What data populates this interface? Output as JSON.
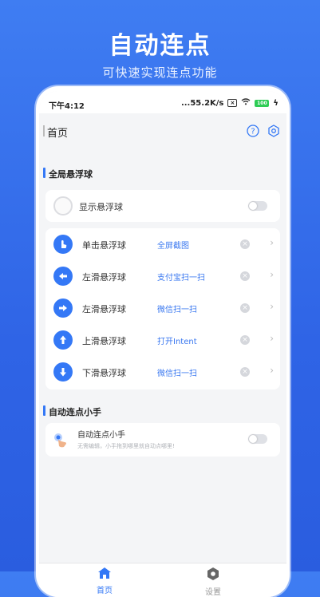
{
  "promo": {
    "title": "自动连点",
    "subtitle": "可快速实现连点功能"
  },
  "statusbar": {
    "time": "下午4:12",
    "network": "...55.2K/s",
    "battery": "100"
  },
  "appbar": {
    "title": "首页"
  },
  "global_ball": {
    "section_title": "全局悬浮球",
    "show_label": "显示悬浮球",
    "rows": [
      {
        "label": "单击悬浮球",
        "action": "全屏截图",
        "icon": "tap-icon"
      },
      {
        "label": "左滑悬浮球",
        "action": "支付宝扫一扫",
        "icon": "arrow-left-icon"
      },
      {
        "label": "左滑悬浮球",
        "action": "微信扫一扫",
        "icon": "arrow-right-icon"
      },
      {
        "label": "上滑悬浮球",
        "action": "打开Intent",
        "icon": "arrow-up-icon"
      },
      {
        "label": "下滑悬浮球",
        "action": "微信扫一扫",
        "icon": "arrow-down-icon"
      }
    ]
  },
  "auto_click": {
    "section_title": "自动连点小手",
    "item_title": "自动连点小手",
    "item_desc": "无需编辑，小手拖到哪里就自动点哪里!"
  },
  "bottomnav": {
    "home": "首页",
    "settings": "设置"
  },
  "colors": {
    "accent": "#3478f6",
    "background": "#3f7df2"
  }
}
